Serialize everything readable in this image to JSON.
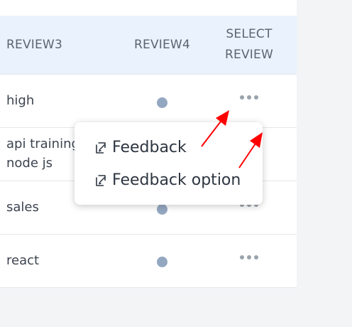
{
  "table": {
    "headers": {
      "review3": "REVIEW3",
      "review4": "REVIEW4",
      "select_review_line1": "SELECT",
      "select_review_line2": "REVIEW"
    },
    "rows": [
      {
        "review3": "high",
        "review3_line2": ""
      },
      {
        "review3": "api training",
        "review3_line2": "node js"
      },
      {
        "review3": "sales",
        "review3_line2": ""
      },
      {
        "review3": "react",
        "review3_line2": ""
      }
    ]
  },
  "popup": {
    "items": [
      {
        "label": "Feedback",
        "icon": "edit-note-icon"
      },
      {
        "label": "Feedback option",
        "icon": "edit-note-icon"
      }
    ]
  },
  "colors": {
    "header_bg": "#eaf3fd",
    "status_dot": "#94a7c1",
    "annotation_arrow": "#ff0000"
  }
}
